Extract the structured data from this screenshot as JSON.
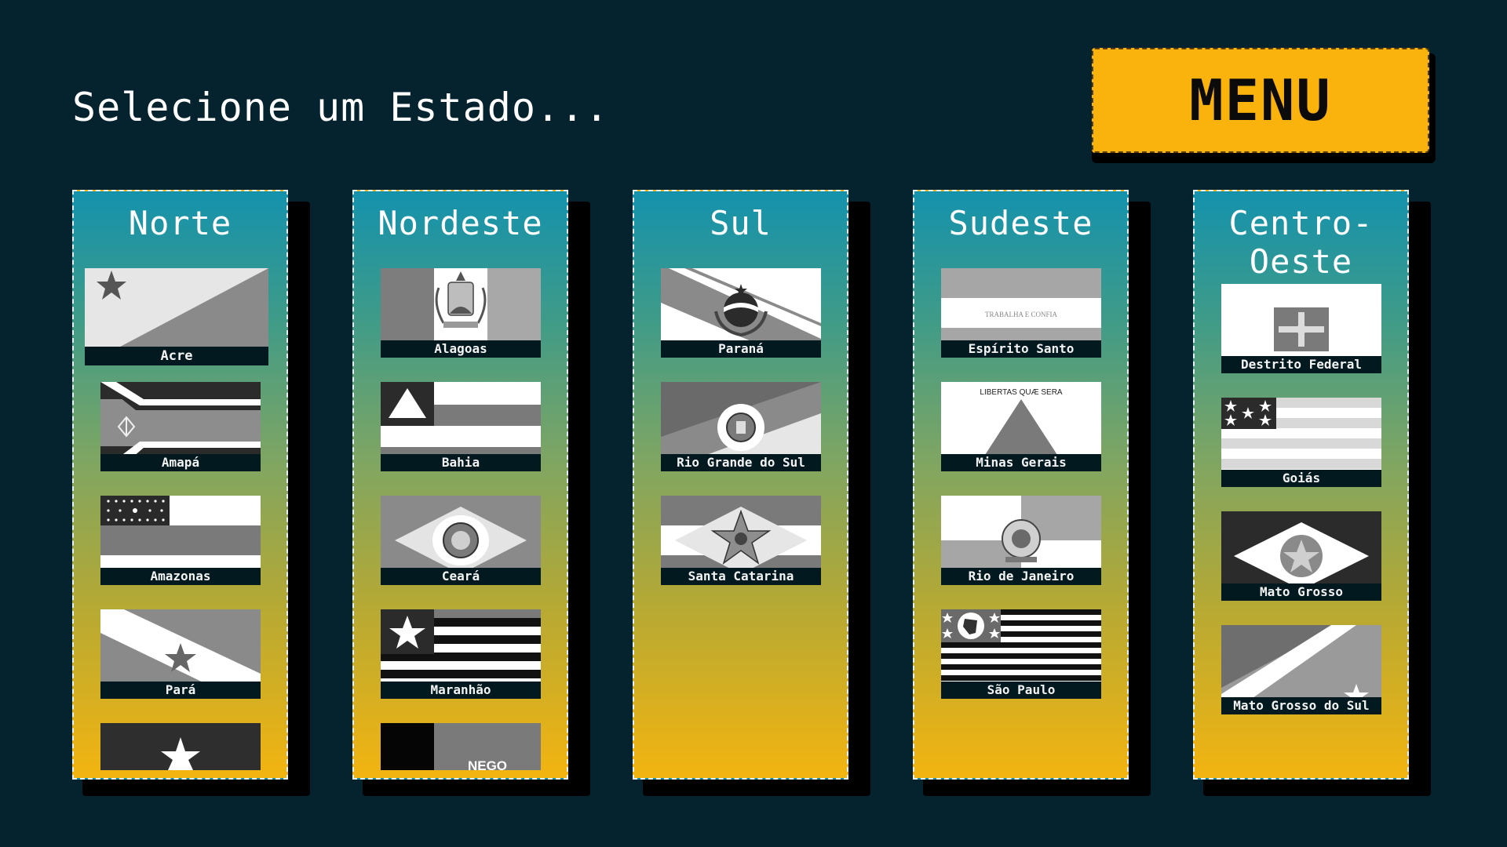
{
  "page": {
    "title": "Selecione um Estado..."
  },
  "menu": {
    "label": "MENU",
    "color": "#fab30c"
  },
  "colors": {
    "background": "#05232f",
    "gradient_top": "#1492ad",
    "gradient_bottom": "#f3b410"
  },
  "regions": [
    {
      "title": "Norte",
      "states": [
        {
          "name": "Acre",
          "flag_icon": "acre-flag-icon"
        },
        {
          "name": "Amapá",
          "flag_icon": "amapa-flag-icon"
        },
        {
          "name": "Amazonas",
          "flag_icon": "amazonas-flag-icon"
        },
        {
          "name": "Pará",
          "flag_icon": "para-flag-icon"
        },
        {
          "name": "",
          "flag_icon": "roraima-partial-flag-icon"
        }
      ]
    },
    {
      "title": "Nordeste",
      "states": [
        {
          "name": "Alagoas",
          "flag_icon": "alagoas-flag-icon"
        },
        {
          "name": "Bahia",
          "flag_icon": "bahia-flag-icon"
        },
        {
          "name": "Ceará",
          "flag_icon": "ceara-flag-icon"
        },
        {
          "name": "Maranhão",
          "flag_icon": "maranhao-flag-icon"
        },
        {
          "name": "",
          "flag_icon": "paraiba-partial-flag-icon",
          "flag_text": "NEGO"
        }
      ]
    },
    {
      "title": "Sul",
      "states": [
        {
          "name": "Paraná",
          "flag_icon": "parana-flag-icon"
        },
        {
          "name": "Rio Grande do Sul",
          "flag_icon": "rio-grande-do-sul-flag-icon"
        },
        {
          "name": "Santa Catarina",
          "flag_icon": "santa-catarina-flag-icon"
        }
      ]
    },
    {
      "title": "Sudeste",
      "states": [
        {
          "name": "Espírito Santo",
          "flag_icon": "espirito-santo-flag-icon",
          "flag_text": "TRABALHA E CONFIA"
        },
        {
          "name": "Minas Gerais",
          "flag_icon": "minas-gerais-flag-icon",
          "flag_text": "LIBERTAS QUÆ SERA"
        },
        {
          "name": "Rio de Janeiro",
          "flag_icon": "rio-de-janeiro-flag-icon"
        },
        {
          "name": "São Paulo",
          "flag_icon": "sao-paulo-flag-icon"
        }
      ]
    },
    {
      "title": "Centro-\nOeste",
      "states": [
        {
          "name": "Destrito Federal",
          "flag_icon": "distrito-federal-flag-icon"
        },
        {
          "name": "Goiás",
          "flag_icon": "goias-flag-icon"
        },
        {
          "name": "Mato Grosso",
          "flag_icon": "mato-grosso-flag-icon"
        },
        {
          "name": "Mato Grosso do Sul",
          "flag_icon": "mato-grosso-do-sul-flag-icon"
        }
      ]
    }
  ]
}
